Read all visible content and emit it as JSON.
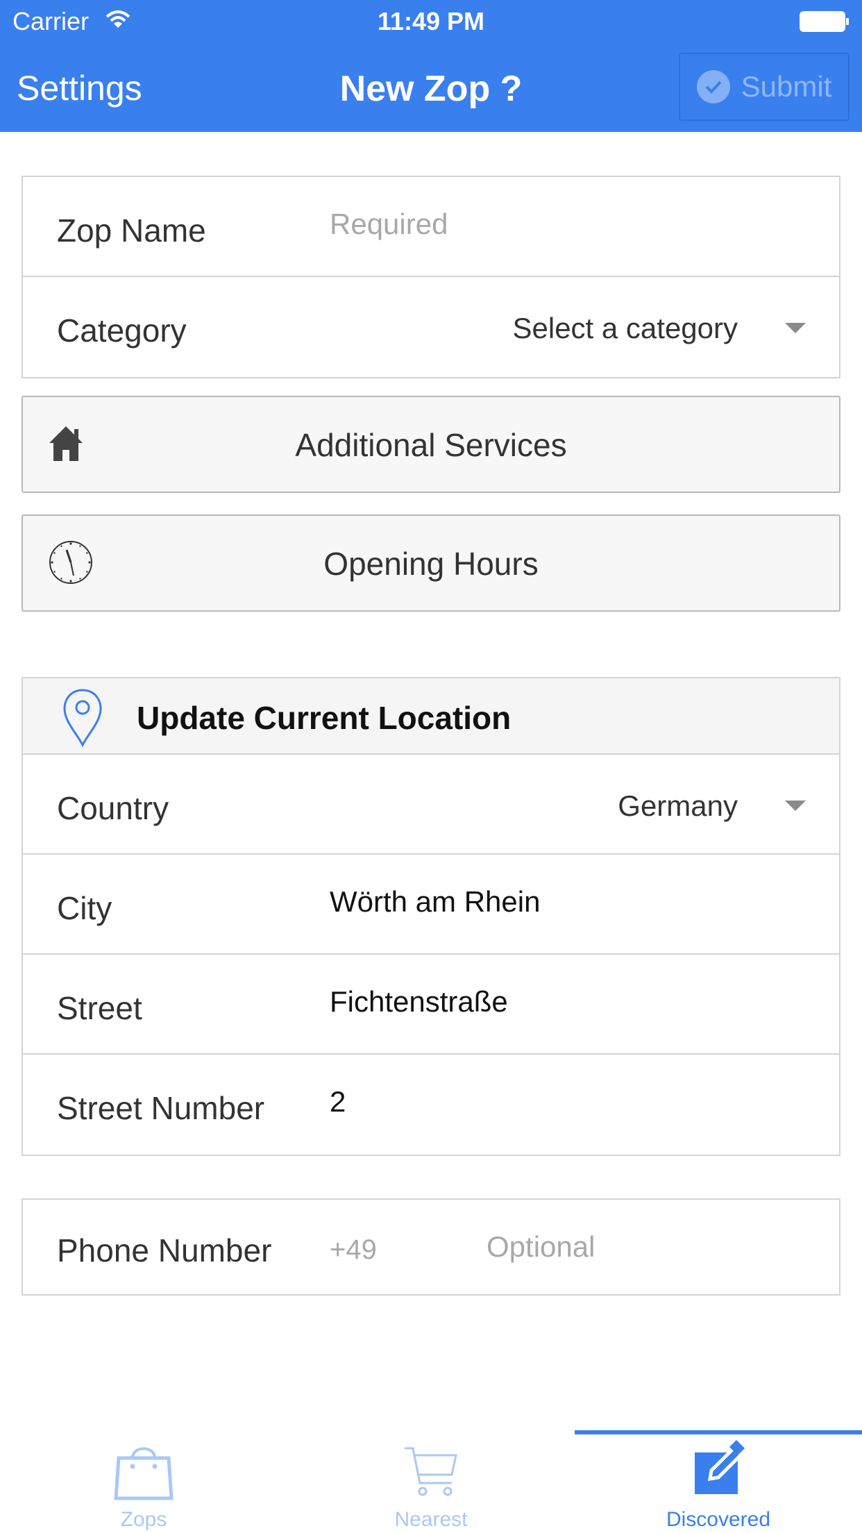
{
  "status_bar": {
    "carrier": "Carrier",
    "time": "11:49 PM"
  },
  "nav": {
    "left_label": "Settings",
    "title": "New Zop ?",
    "submit_label": "Submit"
  },
  "basic": {
    "name": {
      "label": "Zop Name",
      "placeholder": "Required"
    },
    "category": {
      "label": "Category",
      "value": "Select a category"
    }
  },
  "buttons": {
    "services": "Additional Services",
    "hours": "Opening Hours"
  },
  "location": {
    "header": "Update Current Location",
    "country": {
      "label": "Country",
      "value": "Germany"
    },
    "city": {
      "label": "City",
      "value": "Wörth am Rhein"
    },
    "street": {
      "label": "Street",
      "value": "Fichtenstraße"
    },
    "number": {
      "label": "Street Number",
      "value": "2"
    }
  },
  "phone": {
    "label": "Phone Number",
    "prefix": "+49",
    "placeholder": "Optional"
  },
  "tabs": [
    {
      "label": "Zops",
      "icon": "shopping-bag-icon"
    },
    {
      "label": "Nearest",
      "icon": "cart-icon"
    },
    {
      "label": "Discovered",
      "icon": "edit-icon",
      "active": true
    }
  ],
  "colors": {
    "accent": "#3a7fee",
    "inactive_tab": "#a9c8f6",
    "border": "#d4d4d4"
  }
}
